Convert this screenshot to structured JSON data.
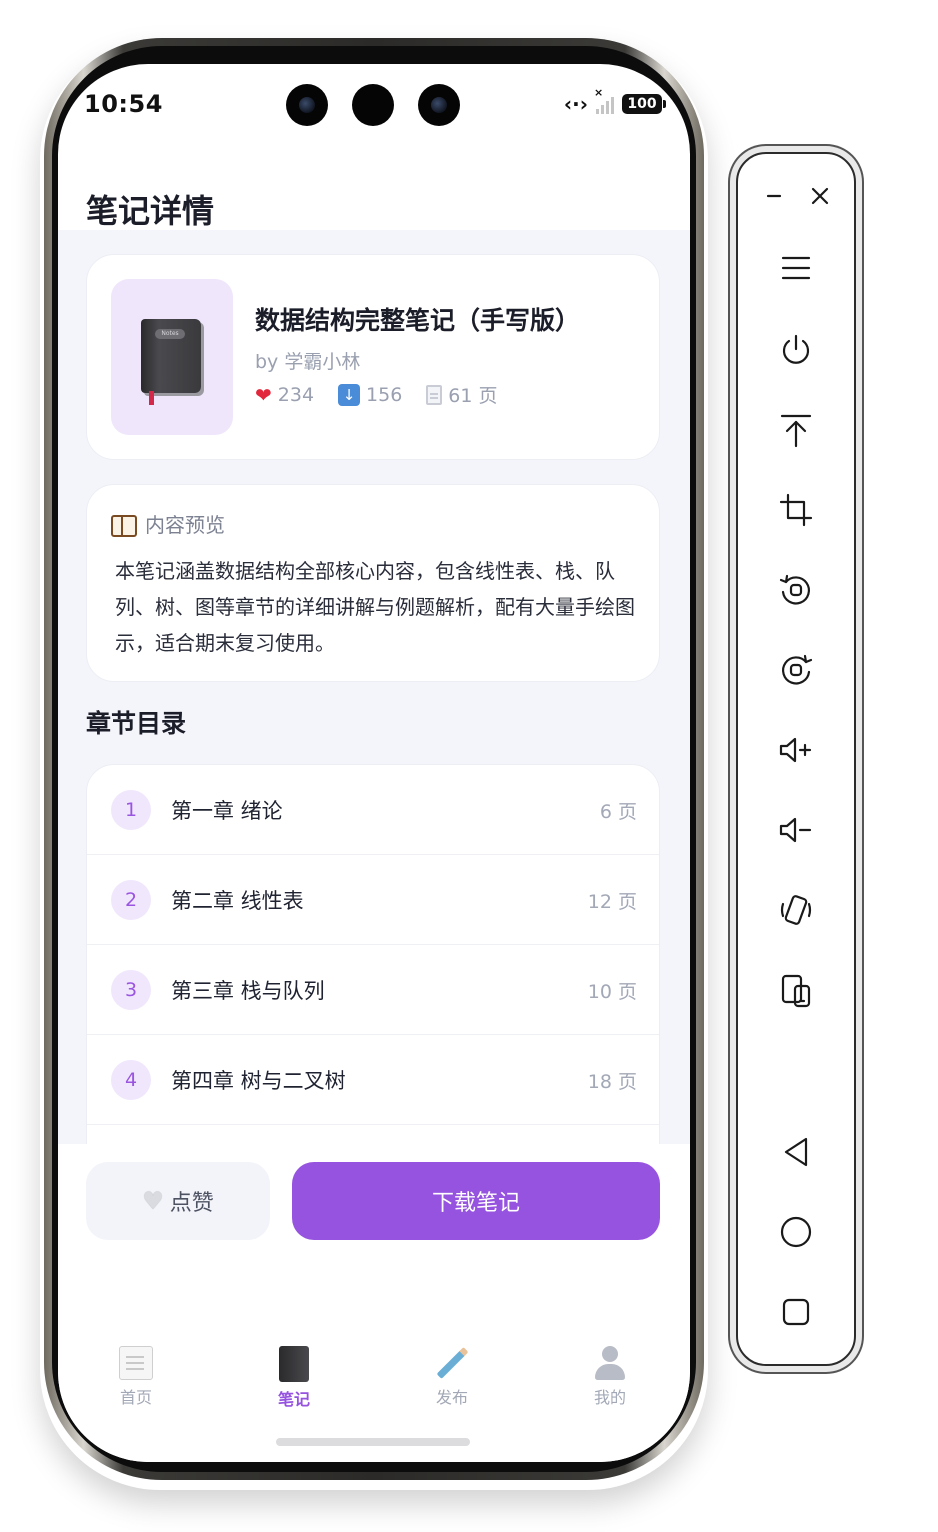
{
  "status_bar": {
    "time": "10:54",
    "battery": "100"
  },
  "header": {
    "title": "笔记详情"
  },
  "note": {
    "title": "数据结构完整笔记（手写版）",
    "author": "by 学霸小林",
    "likes": "234",
    "downloads": "156",
    "pages": "61 页"
  },
  "preview": {
    "heading": "内容预览",
    "text": "本笔记涵盖数据结构全部核心内容，包含线性表、栈、队列、树、图等章节的详细讲解与例题解析，配有大量手绘图示，适合期末复习使用。"
  },
  "chapters": {
    "heading": "章节目录",
    "items": [
      {
        "num": "1",
        "title": "第一章 绪论",
        "pages": "6 页"
      },
      {
        "num": "2",
        "title": "第二章 线性表",
        "pages": "12 页"
      },
      {
        "num": "3",
        "title": "第三章 栈与队列",
        "pages": "10 页"
      },
      {
        "num": "4",
        "title": "第四章 树与二叉树",
        "pages": "18 页"
      }
    ]
  },
  "actions": {
    "like_label": "点赞",
    "download_label": "下载笔记"
  },
  "tabs": [
    {
      "label": "首页",
      "icon": "memo-icon"
    },
    {
      "label": "笔记",
      "icon": "notebook-icon",
      "active": true
    },
    {
      "label": "发布",
      "icon": "pencil-icon"
    },
    {
      "label": "我的",
      "icon": "user-icon"
    }
  ],
  "colors": {
    "accent": "#9653df",
    "background": "#f4f5fa",
    "muted_text": "#9aa0b0"
  },
  "emulator_toolbar": {
    "buttons": [
      "minimize-icon",
      "close-icon",
      "menu-icon",
      "power-icon",
      "pin-top-icon",
      "crop-icon",
      "rotate-left-icon",
      "rotate-right-icon",
      "volume-up-icon",
      "volume-down-icon",
      "shake-icon",
      "device-switch-icon",
      "back-icon",
      "home-icon",
      "recents-icon"
    ]
  }
}
